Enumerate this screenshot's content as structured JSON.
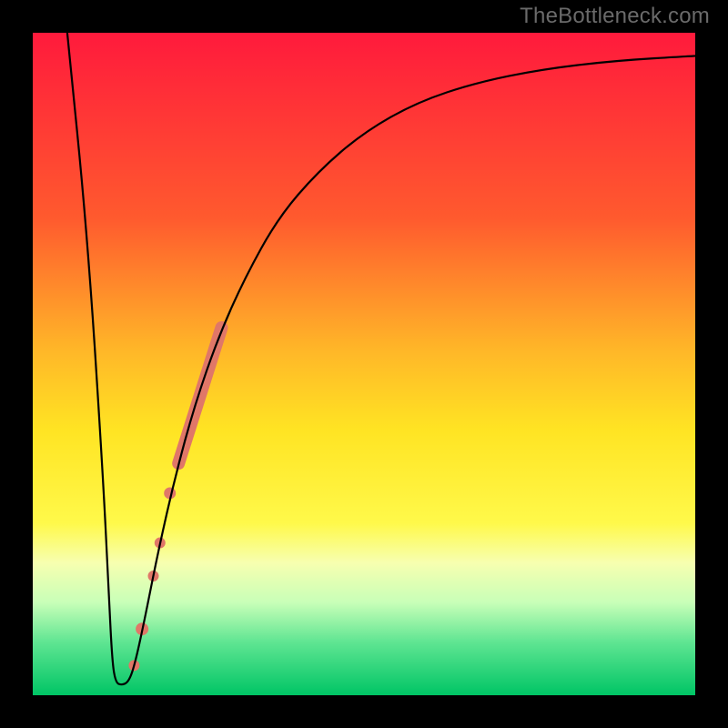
{
  "watermark": "TheBottleneck.com",
  "chart_data": {
    "type": "line",
    "title": "",
    "xlabel": "",
    "ylabel": "",
    "xlim": [
      0,
      100
    ],
    "ylim": [
      0,
      100
    ],
    "gradient_stops": [
      {
        "offset": 0.0,
        "color": "#ff1a3c"
      },
      {
        "offset": 0.28,
        "color": "#ff5a2e"
      },
      {
        "offset": 0.48,
        "color": "#ffb728"
      },
      {
        "offset": 0.6,
        "color": "#ffe423"
      },
      {
        "offset": 0.74,
        "color": "#fff94a"
      },
      {
        "offset": 0.8,
        "color": "#f7ffb0"
      },
      {
        "offset": 0.86,
        "color": "#c8ffb8"
      },
      {
        "offset": 0.92,
        "color": "#5fe592"
      },
      {
        "offset": 1.0,
        "color": "#00c565"
      }
    ],
    "series": [
      {
        "name": "curve",
        "points": [
          {
            "x": 5.2,
            "y": 100.0
          },
          {
            "x": 8.2,
            "y": 70.0
          },
          {
            "x": 10.5,
            "y": 35.0
          },
          {
            "x": 11.5,
            "y": 15.0
          },
          {
            "x": 12.0,
            "y": 5.0
          },
          {
            "x": 12.5,
            "y": 2.0
          },
          {
            "x": 13.3,
            "y": 1.5
          },
          {
            "x": 14.5,
            "y": 2.0
          },
          {
            "x": 15.5,
            "y": 5.0
          },
          {
            "x": 17.0,
            "y": 12.0
          },
          {
            "x": 19.0,
            "y": 22.0
          },
          {
            "x": 21.5,
            "y": 33.0
          },
          {
            "x": 24.5,
            "y": 44.0
          },
          {
            "x": 28.0,
            "y": 54.0
          },
          {
            "x": 32.0,
            "y": 63.0
          },
          {
            "x": 37.0,
            "y": 72.0
          },
          {
            "x": 43.0,
            "y": 79.0
          },
          {
            "x": 50.0,
            "y": 85.0
          },
          {
            "x": 58.0,
            "y": 89.5
          },
          {
            "x": 67.0,
            "y": 92.5
          },
          {
            "x": 77.0,
            "y": 94.5
          },
          {
            "x": 88.0,
            "y": 95.8
          },
          {
            "x": 100.0,
            "y": 96.5
          }
        ]
      }
    ],
    "highlight_band": {
      "start": {
        "x": 22.0,
        "y": 35.0
      },
      "end": {
        "x": 28.5,
        "y": 55.5
      },
      "color": "#e07768",
      "width": 14
    },
    "highlight_dots": [
      {
        "x": 20.7,
        "y": 30.5,
        "r": 6.5,
        "color": "#e07768"
      },
      {
        "x": 19.2,
        "y": 23.0,
        "r": 6,
        "color": "#e07768"
      },
      {
        "x": 18.2,
        "y": 18.0,
        "r": 6,
        "color": "#e07768"
      },
      {
        "x": 16.5,
        "y": 10.0,
        "r": 7,
        "color": "#e07768"
      },
      {
        "x": 15.3,
        "y": 4.5,
        "r": 6,
        "color": "#e07768"
      }
    ]
  }
}
